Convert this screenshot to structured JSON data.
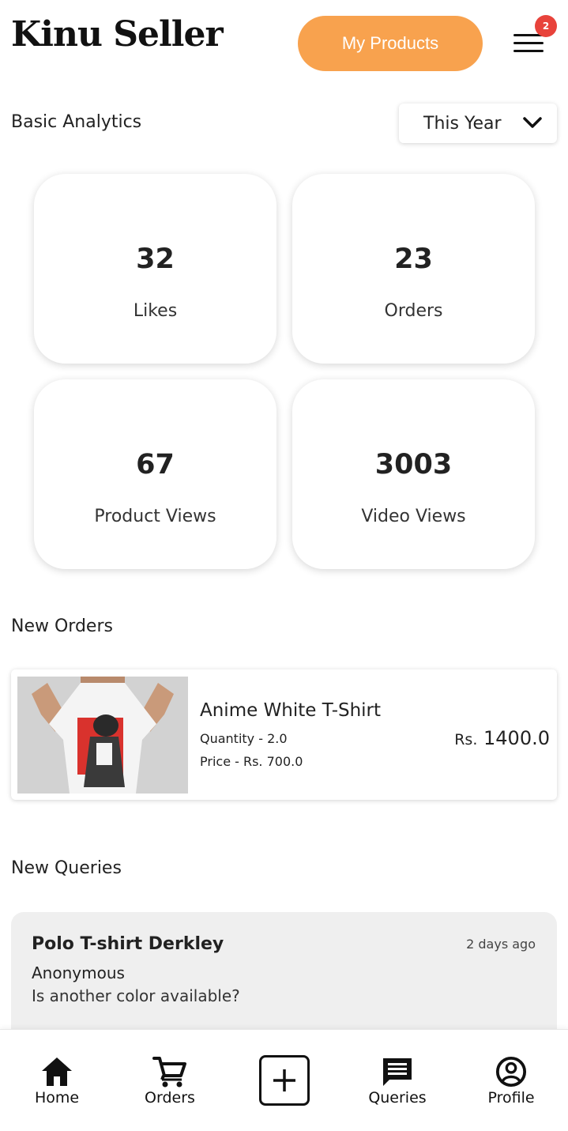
{
  "header": {
    "app_title": "Kinu Seller",
    "my_products_label": "My Products",
    "notification_count": "2"
  },
  "analytics": {
    "section_title": "Basic Analytics",
    "period": "This Year",
    "stats": [
      {
        "value": "32",
        "label": "Likes"
      },
      {
        "value": "23",
        "label": "Orders"
      },
      {
        "value": "67",
        "label": "Product Views"
      },
      {
        "value": "3003",
        "label": "Video Views"
      }
    ]
  },
  "new_orders": {
    "section_title": "New Orders",
    "items": [
      {
        "name": "Anime White T-Shirt",
        "quantity": "Quantity - 2.0",
        "price": "Price - Rs. 700.0",
        "total_currency": "Rs.",
        "total_amount": "1400.0"
      }
    ]
  },
  "new_queries": {
    "section_title": "New Queries",
    "items": [
      {
        "product": "Polo T-shirt Derkley",
        "time": "2 days ago",
        "user": "Anonymous",
        "message": "Is another color available?"
      }
    ]
  },
  "bottom_nav": {
    "items": [
      {
        "label": "Home",
        "icon": "home-icon"
      },
      {
        "label": "Orders",
        "icon": "cart-icon"
      },
      {
        "label": "",
        "icon": "add-icon"
      },
      {
        "label": "Queries",
        "icon": "message-icon"
      },
      {
        "label": "Profile",
        "icon": "profile-icon"
      }
    ]
  },
  "colors": {
    "accent": "#F8A24E",
    "badge": "#E8433B",
    "query_card_bg": "#EFEFEF"
  }
}
